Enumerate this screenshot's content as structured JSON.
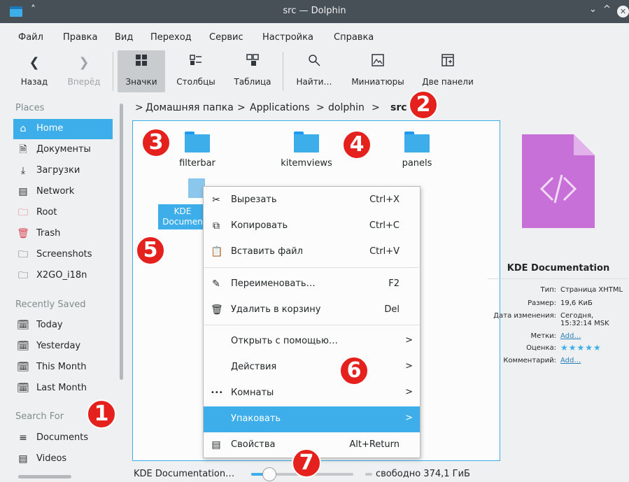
{
  "window": {
    "title": "src — Dolphin",
    "minimize": "⌄",
    "maximize": "^",
    "close": "✕"
  },
  "menubar": [
    "Файл",
    "Правка",
    "Вид",
    "Переход",
    "Сервис",
    "Настройка",
    "Справка"
  ],
  "toolbar": {
    "back": "Назад",
    "forward": "Вперёд",
    "icons": "Значки",
    "columns": "Столбцы",
    "table": "Таблица",
    "find": "Найти…",
    "thumbnails": "Миниатюры",
    "split": "Две панели"
  },
  "sidebar": {
    "places_header": "Places",
    "places": [
      {
        "label": "Home",
        "icon": "home-icon"
      },
      {
        "label": "Документы",
        "icon": "documents-icon"
      },
      {
        "label": "Загрузки",
        "icon": "downloads-icon"
      },
      {
        "label": "Network",
        "icon": "network-icon"
      },
      {
        "label": "Root",
        "icon": "root-folder-icon"
      },
      {
        "label": "Trash",
        "icon": "trash-icon"
      },
      {
        "label": "Screenshots",
        "icon": "folder-icon"
      },
      {
        "label": "X2GO_i18n",
        "icon": "folder-icon"
      }
    ],
    "recent_header": "Recently Saved",
    "recent": [
      {
        "label": "Today",
        "icon": "calendar-icon"
      },
      {
        "label": "Yesterday",
        "icon": "calendar-icon"
      },
      {
        "label": "This Month",
        "icon": "calendar-icon"
      },
      {
        "label": "Last Month",
        "icon": "calendar-icon"
      }
    ],
    "search_header": "Search For",
    "search": [
      {
        "label": "Documents",
        "icon": "text-lines-icon"
      },
      {
        "label": "Videos",
        "icon": "film-icon"
      }
    ]
  },
  "breadcrumb": {
    "sep": ">",
    "items": [
      "Домашняя папка",
      "Applications",
      "dolphin"
    ],
    "current": "src"
  },
  "files": {
    "folders": [
      "filterbar",
      "kitemviews",
      "panels"
    ],
    "selected_file_line1": "KDE",
    "selected_file_line2": "Documen"
  },
  "context_menu": [
    {
      "label": "Вырезать",
      "shortcut": "Ctrl+X",
      "icon": "scissors-icon"
    },
    {
      "label": "Копировать",
      "shortcut": "Ctrl+C",
      "icon": "copy-icon"
    },
    {
      "label": "Вставить файл",
      "shortcut": "Ctrl+V",
      "icon": "paste-icon"
    },
    {
      "label": "Переименовать…",
      "shortcut": "F2",
      "icon": "pencil-icon"
    },
    {
      "label": "Удалить в корзину",
      "shortcut": "Del",
      "icon": "trash-icon"
    },
    {
      "label": "Открыть с помощью…",
      "submenu": ">"
    },
    {
      "label": "Действия",
      "submenu": ">"
    },
    {
      "label": "Комнаты",
      "submenu": ">",
      "icon": "dots-icon"
    },
    {
      "label": "Упаковать",
      "submenu": ">"
    },
    {
      "label": "Свойства",
      "shortcut": "Alt+Return",
      "icon": "properties-icon"
    }
  ],
  "info_panel": {
    "title": "KDE Documentation",
    "type_k": "Тип:",
    "type_v": "Страница XHTML",
    "size_k": "Размер:",
    "size_v": "19,6 КиБ",
    "modified_k": "Дата изменения:",
    "modified_v1": "Сегодня,",
    "modified_v2": "15:32:14 MSK",
    "tags_k": "Метки:",
    "tags_v": "Add…",
    "rating_k": "Оценка:",
    "rating_v": "★★★★★",
    "comment_k": "Комментарий:",
    "comment_v": "Add…"
  },
  "statusbar": {
    "text": "KDE Documentation…",
    "free": "свободно 374,1 ГиБ",
    "zoom_fraction": 0.14
  },
  "badges": [
    "1",
    "2",
    "3",
    "4",
    "5",
    "6",
    "7"
  ],
  "colors": {
    "accent": "#3daee9",
    "badge": "#e5211e",
    "titlebar": "#475057"
  }
}
